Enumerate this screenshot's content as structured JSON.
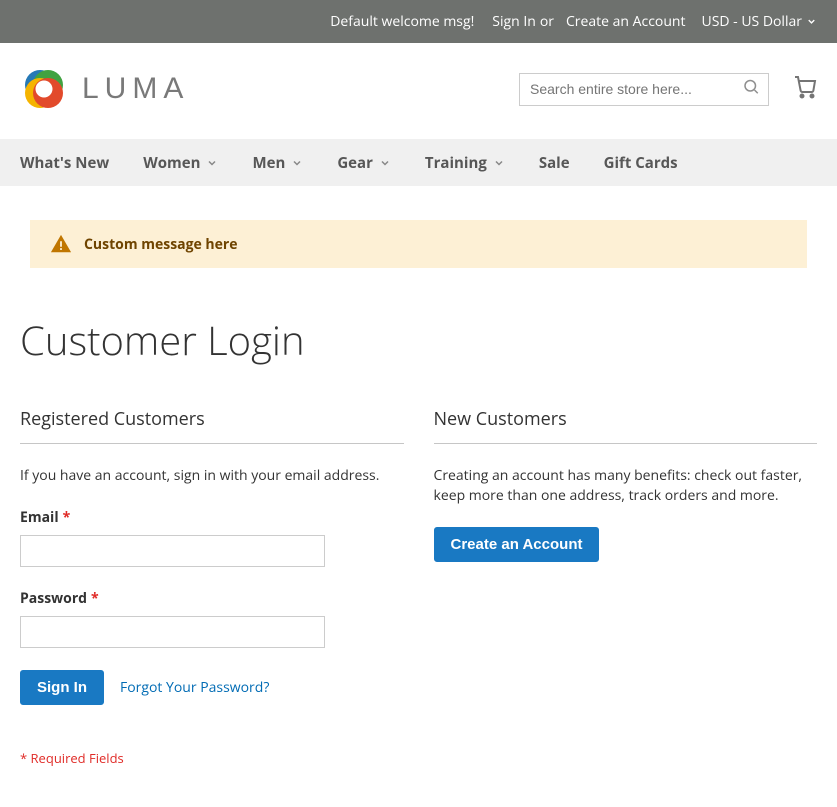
{
  "topbar": {
    "welcome": "Default welcome msg!",
    "signin": "Sign In",
    "or": "or",
    "create": "Create an Account",
    "currency": "USD - US Dollar"
  },
  "logo_text": "LUMA",
  "search": {
    "placeholder": "Search entire store here..."
  },
  "nav": {
    "whats_new": "What's New",
    "women": "Women",
    "men": "Men",
    "gear": "Gear",
    "training": "Training",
    "sale": "Sale",
    "gift_cards": "Gift Cards"
  },
  "notice": "Custom message here",
  "page_title": "Customer Login",
  "login": {
    "title": "Registered Customers",
    "note": "If you have an account, sign in with your email address.",
    "email_label": "Email",
    "password_label": "Password",
    "signin_button": "Sign In",
    "forgot": "Forgot Your Password?",
    "required_note": "* Required Fields"
  },
  "new": {
    "title": "New Customers",
    "note": "Creating an account has many benefits: check out faster, keep more than one address, track orders and more.",
    "create_button": "Create an Account"
  }
}
